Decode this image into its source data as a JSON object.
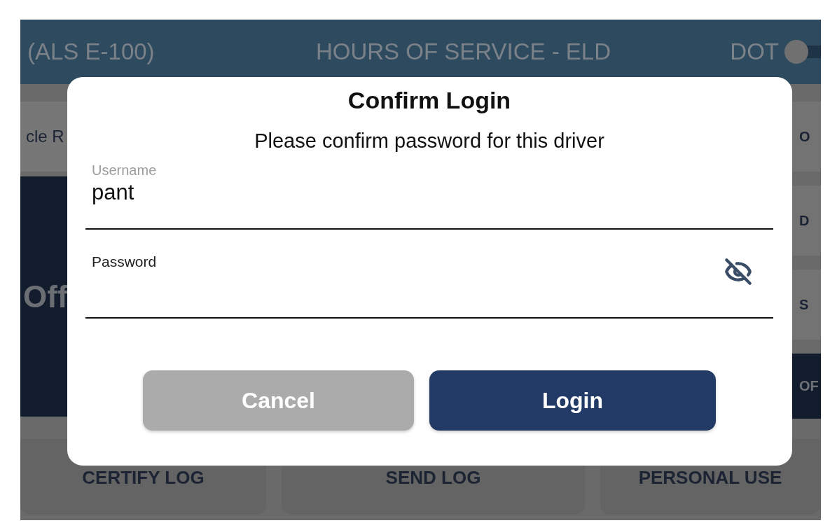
{
  "header": {
    "unit": "(ALS E-100)",
    "title": "HOURS OF SERVICE - ELD",
    "dot_toggle": {
      "label": "DOT",
      "on": false
    }
  },
  "left_panel": {
    "button": "cle R",
    "status": "Off"
  },
  "right_buttons": [
    {
      "label": "O",
      "kind": "plain"
    },
    {
      "label": "D",
      "kind": "plain"
    },
    {
      "label": "S",
      "kind": "plain"
    },
    {
      "label": "OF",
      "kind": "dark"
    }
  ],
  "bottom_buttons": [
    "CERTIFY LOG",
    "SEND LOG",
    "PERSONAL USE"
  ],
  "dialog": {
    "title": "Confirm Login",
    "message": "Please confirm password for this driver",
    "fields": [
      {
        "kind": "text",
        "label": "Username",
        "value": "pant"
      },
      {
        "kind": "password",
        "label": "Password",
        "revealed": false
      }
    ],
    "buttons": [
      {
        "label": "Cancel",
        "kind": "secondary"
      },
      {
        "label": "Login",
        "kind": "primary"
      }
    ]
  }
}
